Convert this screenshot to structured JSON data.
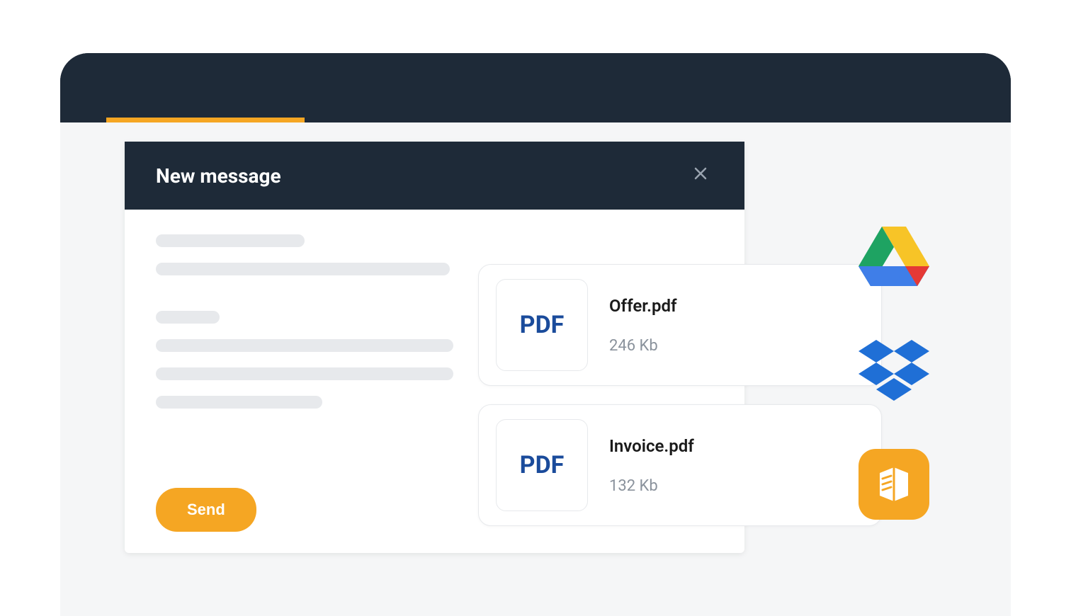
{
  "compose": {
    "title": "New message",
    "send_label": "Send",
    "close_icon": "close-icon"
  },
  "attachments": [
    {
      "type_label": "PDF",
      "name": "Offer.pdf",
      "size": "246 Kb"
    },
    {
      "type_label": "PDF",
      "name": "Invoice.pdf",
      "size": "132 Kb"
    }
  ],
  "providers": [
    {
      "id": "google-drive",
      "name": "google-drive-icon"
    },
    {
      "id": "dropbox",
      "name": "dropbox-icon"
    },
    {
      "id": "library",
      "name": "library-icon"
    }
  ]
}
